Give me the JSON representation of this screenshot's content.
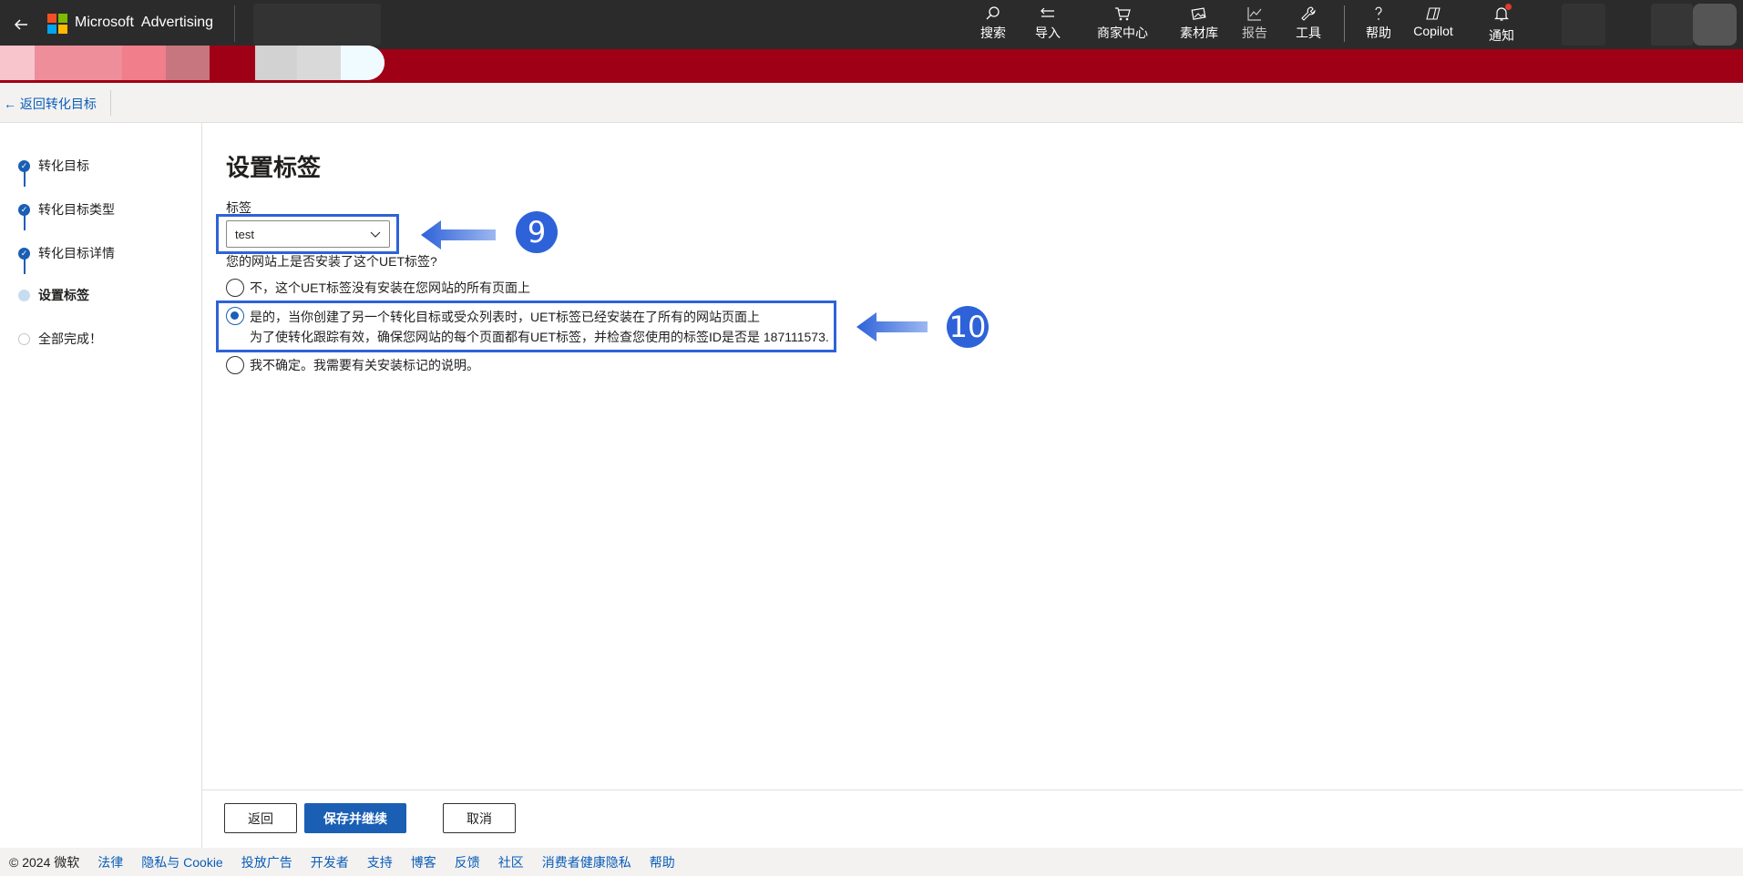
{
  "topbar": {
    "brand_main": "Microsoft",
    "brand_sub": "Advertising",
    "nav": [
      {
        "label": "搜索",
        "icon": "search-icon"
      },
      {
        "label": "导入",
        "icon": "import-icon"
      },
      {
        "label": "商家中心",
        "icon": "cart-icon"
      },
      {
        "label": "素材库",
        "icon": "image-library-icon"
      },
      {
        "label": "报告",
        "icon": "chart-icon"
      },
      {
        "label": "工具",
        "icon": "wrench-icon"
      },
      {
        "label": "帮助",
        "icon": "help-icon"
      },
      {
        "label": "Copilot",
        "icon": "copilot-icon"
      },
      {
        "label": "通知",
        "icon": "bell-icon"
      }
    ],
    "colors": {
      "bar": "#2b2b2b",
      "account_band": "#a00016",
      "ms_red": "#f25022",
      "ms_green": "#7fba00",
      "ms_blue": "#00a4ef",
      "ms_yellow": "#ffb900"
    }
  },
  "subheader": {
    "back_link": "← 返回转化目标"
  },
  "stepper": {
    "steps": [
      {
        "label": "转化目标",
        "state": "done"
      },
      {
        "label": "转化目标类型",
        "state": "done"
      },
      {
        "label": "转化目标详情",
        "state": "done"
      },
      {
        "label": "设置标签",
        "state": "current"
      },
      {
        "label": "全部完成！",
        "state": "todo"
      }
    ]
  },
  "main": {
    "title": "设置标签",
    "tag_label": "标签",
    "tag_select_value": "test",
    "question": "您的网站上是否安装了这个UET标签?",
    "options": [
      {
        "line1": "不，这个UET标签没有安装在您网站的所有页面上",
        "line2": "",
        "selected": false
      },
      {
        "line1": "是的，当你创建了另一个转化目标或受众列表时，UET标签已经安装在了所有的网站页面上",
        "line2": "为了使转化跟踪有效，确保您网站的每个页面都有UET标签，并检查您使用的标签ID是否是 187111573.",
        "selected": true
      },
      {
        "line1": "我不确定。我需要有关安装标记的说明。",
        "line2": "",
        "selected": false
      }
    ],
    "annotations": [
      {
        "badge": "9"
      },
      {
        "badge": "10"
      }
    ],
    "accent": "#2e62d9"
  },
  "actions": {
    "back": "返回",
    "save": "保存并继续",
    "cancel": "取消"
  },
  "footer": {
    "copyright": "© 2024 微软",
    "links": [
      "法律",
      "隐私与 Cookie",
      "投放广告",
      "开发者",
      "支持",
      "博客",
      "反馈",
      "社区",
      "消费者健康隐私",
      "帮助"
    ]
  }
}
